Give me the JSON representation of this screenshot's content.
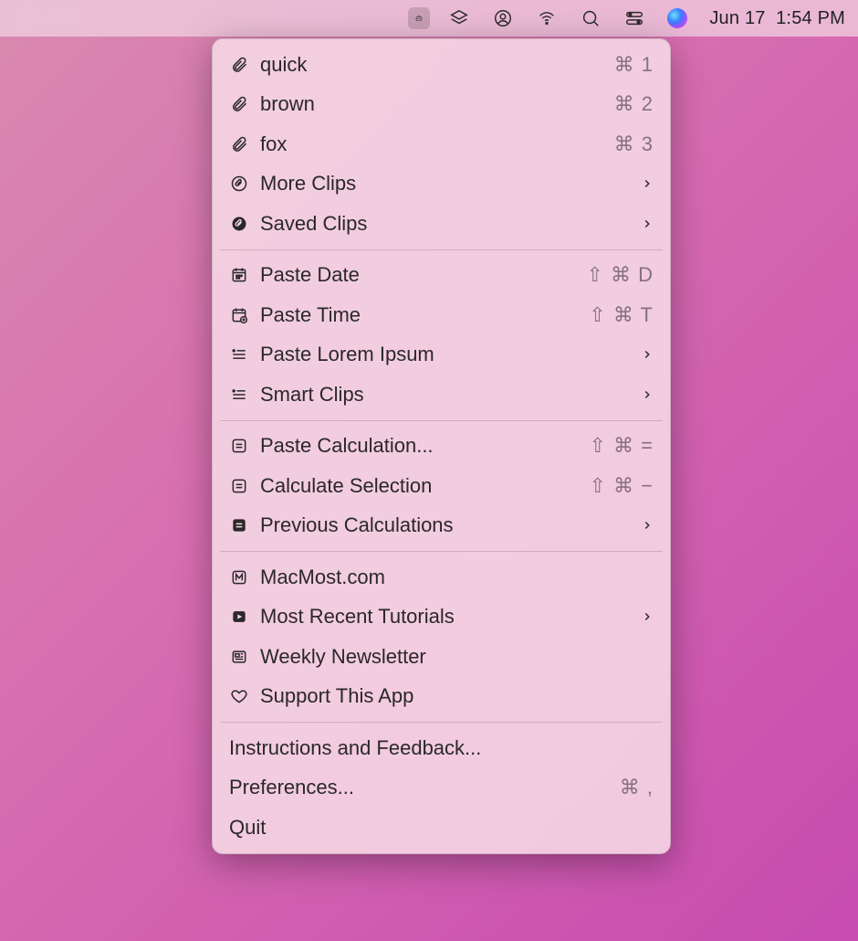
{
  "menubar": {
    "date": "Jun 17",
    "time": "1:54 PM"
  },
  "menu": {
    "sections": [
      [
        {
          "icon": "paperclip",
          "label": "quick",
          "shortcut": "⌘ 1",
          "submenu": false
        },
        {
          "icon": "paperclip",
          "label": "brown",
          "shortcut": "⌘ 2",
          "submenu": false
        },
        {
          "icon": "paperclip",
          "label": "fox",
          "shortcut": "⌘ 3",
          "submenu": false
        },
        {
          "icon": "paperclip-circle",
          "label": "More Clips",
          "shortcut": "",
          "submenu": true
        },
        {
          "icon": "paperclip-circle-fill",
          "label": "Saved Clips",
          "shortcut": "",
          "submenu": true
        }
      ],
      [
        {
          "icon": "calendar",
          "label": "Paste Date",
          "shortcut": "⇧ ⌘ D",
          "submenu": false
        },
        {
          "icon": "calendar-plus",
          "label": "Paste Time",
          "shortcut": "⇧ ⌘ T",
          "submenu": false
        },
        {
          "icon": "list-lines",
          "label": "Paste Lorem Ipsum",
          "shortcut": "",
          "submenu": true
        },
        {
          "icon": "list-lines",
          "label": "Smart Clips",
          "shortcut": "",
          "submenu": true
        }
      ],
      [
        {
          "icon": "equals-box",
          "label": "Paste Calculation...",
          "shortcut": "⇧ ⌘ =",
          "submenu": false
        },
        {
          "icon": "equals-box",
          "label": "Calculate Selection",
          "shortcut": "⇧ ⌘ −",
          "submenu": false
        },
        {
          "icon": "equals-box-fill",
          "label": "Previous Calculations",
          "shortcut": "",
          "submenu": true
        }
      ],
      [
        {
          "icon": "m-box",
          "label": "MacMost.com",
          "shortcut": "",
          "submenu": false
        },
        {
          "icon": "play-fill",
          "label": "Most Recent Tutorials",
          "shortcut": "",
          "submenu": true
        },
        {
          "icon": "newspaper",
          "label": "Weekly Newsletter",
          "shortcut": "",
          "submenu": false
        },
        {
          "icon": "heart",
          "label": "Support This App",
          "shortcut": "",
          "submenu": false
        }
      ],
      [
        {
          "icon": "",
          "label": "Instructions and Feedback...",
          "shortcut": "",
          "submenu": false
        },
        {
          "icon": "",
          "label": "Preferences...",
          "shortcut": "⌘ ,",
          "submenu": false
        },
        {
          "icon": "",
          "label": "Quit",
          "shortcut": "",
          "submenu": false
        }
      ]
    ]
  }
}
